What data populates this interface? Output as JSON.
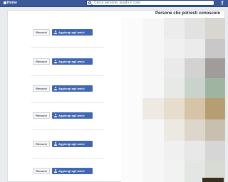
{
  "topbar": {
    "home_label": "Home",
    "search_placeholder": "Cerca persone, luoghi e cose",
    "logo": "f"
  },
  "suggestions": {
    "title": "Persone che potresti conoscere",
    "remove_label": "Rimuovi",
    "add_label": "Aggiungi agli amici",
    "count": 6
  },
  "icons": {
    "search": "search-icon",
    "add_friend": "person-add-icon",
    "home": "home-icon"
  },
  "colors": {
    "brand": "#3b5998",
    "add_button": "#4267b2",
    "remove_button": "#f6f7f9"
  }
}
